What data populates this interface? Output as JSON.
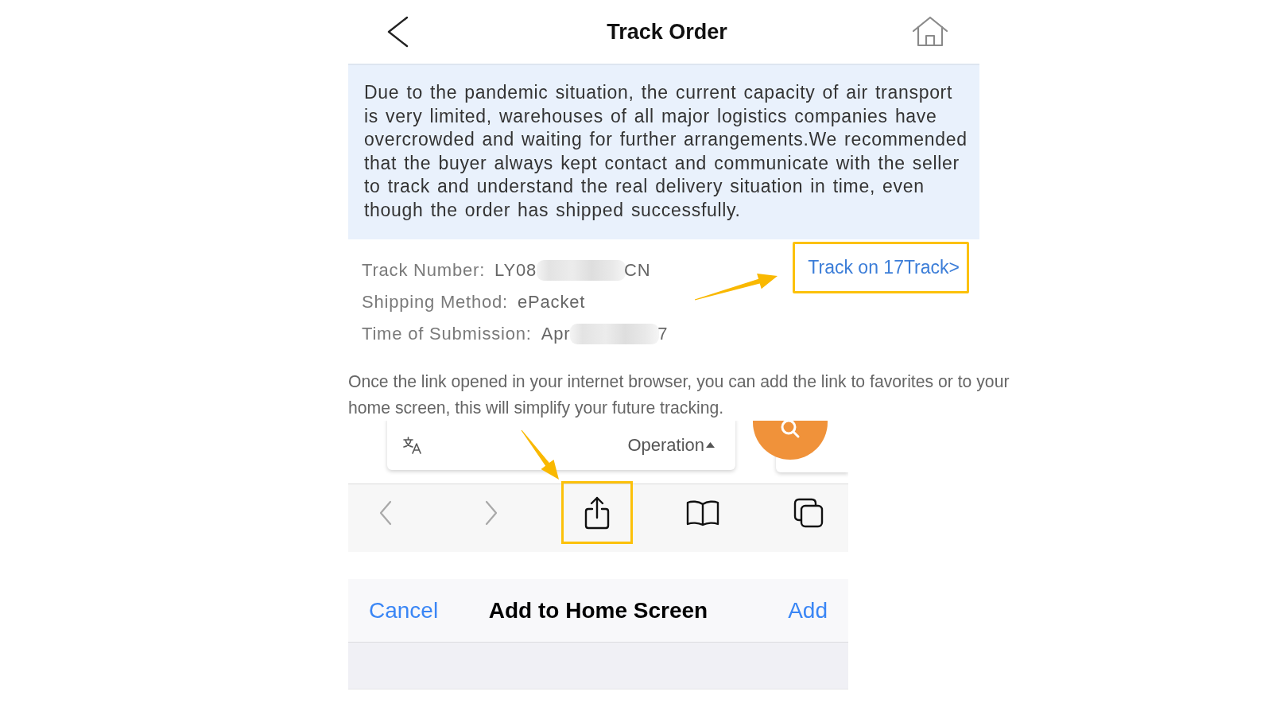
{
  "header": {
    "title": "Track Order"
  },
  "notice": "Due to the pandemic situation, the current capacity of air transport is very limited, warehouses of all major logistics companies have overcrowded and waiting for further arrangements.We recommended that the buyer always kept contact and communicate with the seller to track and understand the real delivery situation in time, even though the order has shipped successfully.",
  "shipment": {
    "fields": [
      {
        "kind": "masked",
        "label": "Track Number:",
        "value_start": "LY08",
        "value_end": "CN"
      },
      {
        "kind": "plain",
        "label": "Shipping Method:",
        "value": "ePacket"
      },
      {
        "kind": "masked",
        "label": "Time of Submission:",
        "value_start": "Apr",
        "value_end": "7"
      }
    ],
    "track_link": {
      "label": "Track on 17Track>",
      "highlighted": true
    }
  },
  "instruction": "Once the link opened in your internet browser, you can add the link to favorites or to your home screen, this will simplify your future tracking.",
  "browser_screenshot": {
    "translate_bar": {
      "label": "Operation"
    },
    "toolbar": [
      {
        "kind": "back",
        "disabled": true,
        "highlighted": false
      },
      {
        "kind": "forward",
        "disabled": true,
        "highlighted": false
      },
      {
        "kind": "share",
        "disabled": false,
        "highlighted": true
      },
      {
        "kind": "bookmarks",
        "disabled": false,
        "highlighted": false
      },
      {
        "kind": "tabs",
        "disabled": false,
        "highlighted": false
      }
    ]
  },
  "add_sheet": {
    "cancel": "Cancel",
    "title": "Add to Home Screen",
    "add": "Add"
  }
}
